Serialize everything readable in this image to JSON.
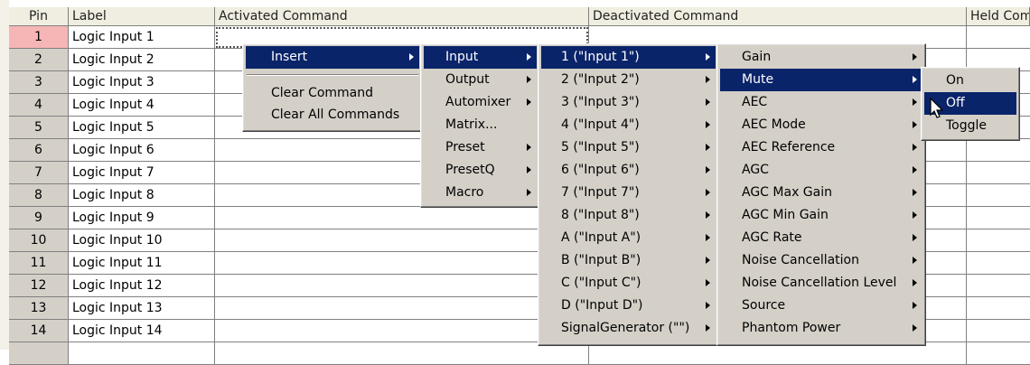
{
  "grid": {
    "headers": {
      "pin": "Pin",
      "label": "Label",
      "activated": "Activated Command",
      "deactivated": "Deactivated Command",
      "held": "Held Comm"
    },
    "rows": [
      {
        "pin": "1",
        "label": "Logic Input 1"
      },
      {
        "pin": "2",
        "label": "Logic Input 2"
      },
      {
        "pin": "3",
        "label": "Logic Input 3"
      },
      {
        "pin": "4",
        "label": "Logic Input 4"
      },
      {
        "pin": "5",
        "label": "Logic Input 5"
      },
      {
        "pin": "6",
        "label": "Logic Input 6"
      },
      {
        "pin": "7",
        "label": "Logic Input 7"
      },
      {
        "pin": "8",
        "label": "Logic Input 8"
      },
      {
        "pin": "9",
        "label": "Logic Input 9"
      },
      {
        "pin": "10",
        "label": "Logic Input 10"
      },
      {
        "pin": "11",
        "label": "Logic Input 11"
      },
      {
        "pin": "12",
        "label": "Logic Input 12"
      },
      {
        "pin": "13",
        "label": "Logic Input 13"
      },
      {
        "pin": "14",
        "label": "Logic Input 14"
      }
    ]
  },
  "menus": {
    "context": {
      "insert": "Insert",
      "clear_command": "Clear Command",
      "clear_all": "Clear All Commands"
    },
    "insert": [
      "Input",
      "Output",
      "Automixer",
      "Matrix...",
      "Preset",
      "PresetQ",
      "Macro"
    ],
    "inputs": [
      "1 (\"Input 1\")",
      "2 (\"Input 2\")",
      "3 (\"Input 3\")",
      "4 (\"Input 4\")",
      "5 (\"Input 5\")",
      "6 (\"Input 6\")",
      "7 (\"Input 7\")",
      "8 (\"Input 8\")",
      "A (\"Input A\")",
      "B (\"Input B\")",
      "C (\"Input C\")",
      "D (\"Input D\")",
      "SignalGenerator (\"\")"
    ],
    "params": [
      "Gain",
      "Mute",
      "AEC",
      "AEC Mode",
      "AEC Reference",
      "AGC",
      "AGC Max Gain",
      "AGC Min Gain",
      "AGC Rate",
      "Noise Cancellation",
      "Noise Cancellation Level",
      "Source",
      "Phantom Power"
    ],
    "mute": [
      "On",
      "Off",
      "Toggle"
    ]
  },
  "colors": {
    "menu_highlight": "#0a246a",
    "selected_pin": "#f6b6b6",
    "menu_face": "#d4d0c8"
  }
}
